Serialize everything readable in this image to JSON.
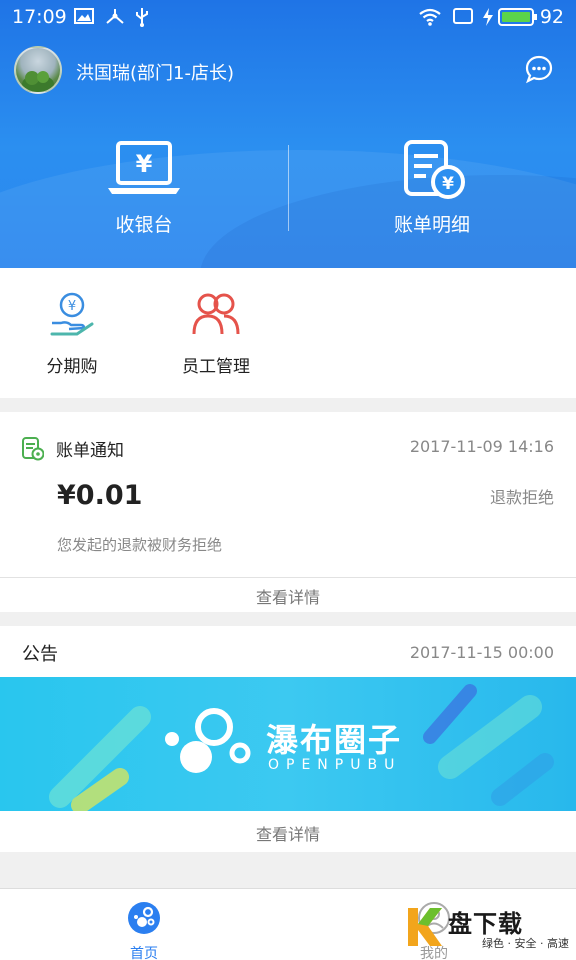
{
  "status_bar": {
    "time": "17:09",
    "battery": "92"
  },
  "header": {
    "username": "洪国瑞(部门1-店长)",
    "actions": [
      {
        "label": "收银台",
        "icon": "cashier-laptop-icon"
      },
      {
        "label": "账单明细",
        "icon": "bill-detail-icon"
      }
    ]
  },
  "services": [
    {
      "label": "分期购",
      "icon": "installment-icon"
    },
    {
      "label": "员工管理",
      "icon": "staff-icon"
    }
  ],
  "bill_notice": {
    "title": "账单通知",
    "time": "2017-11-09 14:16",
    "amount": "¥0.01",
    "status": "退款拒绝",
    "description": "您发起的退款被财务拒绝",
    "more": "查看详情"
  },
  "announcement": {
    "title": "公告",
    "time": "2017-11-15 00:00",
    "banner_title": "瀑布圈子",
    "banner_subtitle": "OPENPUBU",
    "more": "查看详情"
  },
  "bottom_nav": [
    {
      "label": "首页",
      "active": true
    },
    {
      "label": "我的",
      "active": false
    }
  ],
  "watermark": {
    "main": "盘下载",
    "sub": "绿色 · 安全 · 高速"
  },
  "colors": {
    "primary": "#2b7ff0",
    "green": "#4caf50",
    "red": "#e5534b"
  }
}
